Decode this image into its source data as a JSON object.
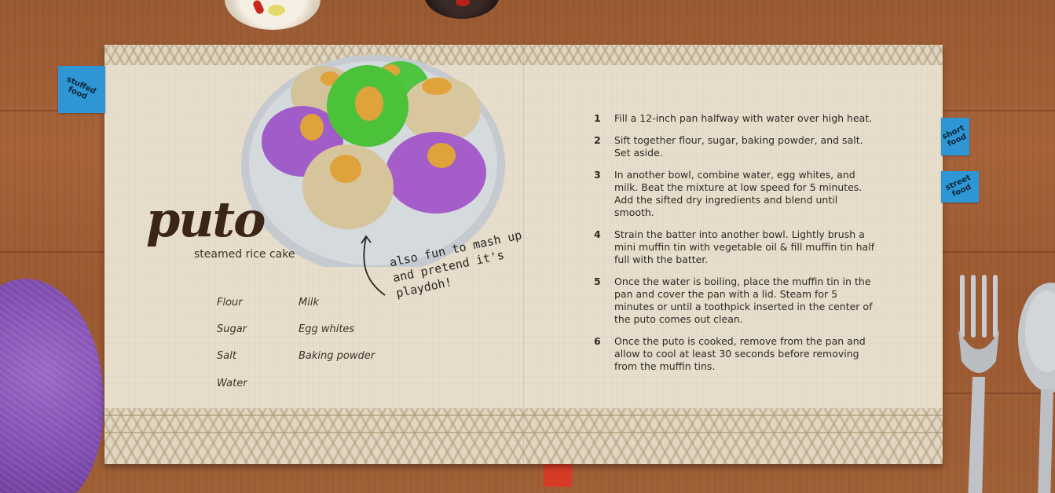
{
  "tabs": {
    "left": "stuffed food",
    "right_top": "short food",
    "right_bottom": "street food"
  },
  "recipe": {
    "title": "puto",
    "subtitle": "steamed rice cake",
    "note": "also fun to mash up and pretend it's playdoh!",
    "ingredients": {
      "col1": [
        "Flour",
        "Sugar",
        "Salt",
        "Water"
      ],
      "col2": [
        "Milk",
        "Egg whites",
        "Baking powder"
      ]
    },
    "steps": [
      {
        "n": "1",
        "text": "Fill a 12-inch pan halfway with water over high heat."
      },
      {
        "n": "2",
        "text": "Sift together flour, sugar, baking powder, and salt. Set aside."
      },
      {
        "n": "3",
        "text": "In another bowl, combine water, egg whites, and milk. Beat the mixture at low speed for 5 minutes. Add the sifted dry ingredients and blend until smooth."
      },
      {
        "n": "4",
        "text": "Strain the batter into another bowl. Lightly brush a mini muffin tin with vegetable oil & fill muffin tin half full with the batter."
      },
      {
        "n": "5",
        "text": "Once the water is boiling, place the muffin tin in the pan and cover the pan with a lid. Steam for 5 minutes or until a toothpick inserted in the center of the puto comes out clean."
      },
      {
        "n": "6",
        "text": "Once the puto is cooked, remove from the pan and allow to cool at least 30 seconds before removing from the muffin tins."
      }
    ]
  },
  "colors": {
    "book_paper": "#e9e0cf",
    "tab_blue": "#2f96d6",
    "ribbon": "#d73b26",
    "puto_purple": "#a05cc8",
    "puto_green": "#4cc23a",
    "puto_tan": "#d6c49a",
    "cheese": "#e0a23a"
  },
  "icons": [
    "plate-illustration",
    "fork-icon",
    "spoon-icon",
    "yarn-ball",
    "bowl"
  ]
}
